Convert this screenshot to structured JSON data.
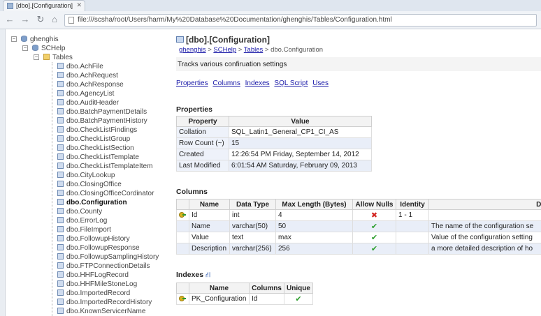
{
  "browser": {
    "tab_title": "[dbo].[Configuration]",
    "url": "file:///scsha/root/Users/harm/My%20Database%20Documentation/ghenghis/Tables/Configuration.html"
  },
  "tree": {
    "server": "ghenghis",
    "database": "SCHelp",
    "folder": "Tables",
    "tables": [
      "dbo.AchFile",
      "dbo.AchRequest",
      "dbo.AchResponse",
      "dbo.AgencyList",
      "dbo.AuditHeader",
      "dbo.BatchPaymentDetails",
      "dbo.BatchPaymentHistory",
      "dbo.CheckListFindings",
      "dbo.CheckListGroup",
      "dbo.CheckListSection",
      "dbo.CheckListTemplate",
      "dbo.CheckListTemplateItem",
      "dbo.CityLookup",
      "dbo.ClosingOffice",
      "dbo.ClosingOfficeCordinator",
      "dbo.Configuration",
      "dbo.County",
      "dbo.ErrorLog",
      "dbo.FileImport",
      "dbo.FollowupHistory",
      "dbo.FollowupResponse",
      "dbo.FollowupSamplingHistory",
      "dbo.FTPConnectionDetails",
      "dbo.HHFLogRecord",
      "dbo.HHFMileStoneLog",
      "dbo.ImportedRecord",
      "dbo.ImportedRecordHistory",
      "dbo.KnownServicerName"
    ],
    "selected": "dbo.Configuration"
  },
  "page": {
    "title": "[dbo].[Configuration]",
    "breadcrumb": {
      "server": "ghenghis",
      "sep1": " > ",
      "database": "SCHelp",
      "sep2": " > ",
      "folder": "Tables",
      "sep3": " > ",
      "current": "dbo.Configuration"
    },
    "description": "Tracks various confiruation settings",
    "nav_links": [
      "Properties",
      "Columns",
      "Indexes",
      "SQL Script",
      "Uses"
    ]
  },
  "properties": {
    "heading": "Properties",
    "headers": [
      "Property",
      "Value"
    ],
    "rows": [
      [
        "Collation",
        "SQL_Latin1_General_CP1_CI_AS"
      ],
      [
        "Row Count (~)",
        "15"
      ],
      [
        "Created",
        "12:26:54 PM Friday, September 14, 2012"
      ],
      [
        "Last Modified",
        "6:01:54 AM Saturday, February 09, 2013"
      ]
    ]
  },
  "columns": {
    "heading": "Columns",
    "headers": [
      "",
      "Name",
      "Data Type",
      "Max Length (Bytes)",
      "Allow Nulls",
      "Identity",
      "Desc"
    ],
    "rows": [
      {
        "key": true,
        "name": "Id",
        "type": "int",
        "max": "4",
        "nulls": "no",
        "identity": "1 - 1",
        "desc": ""
      },
      {
        "key": false,
        "name": "Name",
        "type": "varchar(50)",
        "max": "50",
        "nulls": "yes",
        "identity": "",
        "desc": "The name of the configuration se"
      },
      {
        "key": false,
        "name": "Value",
        "type": "text",
        "max": "max",
        "nulls": "yes",
        "identity": "",
        "desc": "Value of the configuration setting"
      },
      {
        "key": false,
        "name": "Description",
        "type": "varchar(256)",
        "max": "256",
        "nulls": "yes",
        "identity": "",
        "desc": "a more detailed description of ho"
      }
    ]
  },
  "indexes": {
    "heading": "Indexes",
    "headers": [
      "",
      "Name",
      "Columns",
      "Unique"
    ],
    "rows": [
      {
        "key": true,
        "name": "PK_Configuration",
        "columns": "Id",
        "unique": "yes"
      }
    ]
  },
  "icons": {
    "check": "✔",
    "cross": "✖"
  }
}
